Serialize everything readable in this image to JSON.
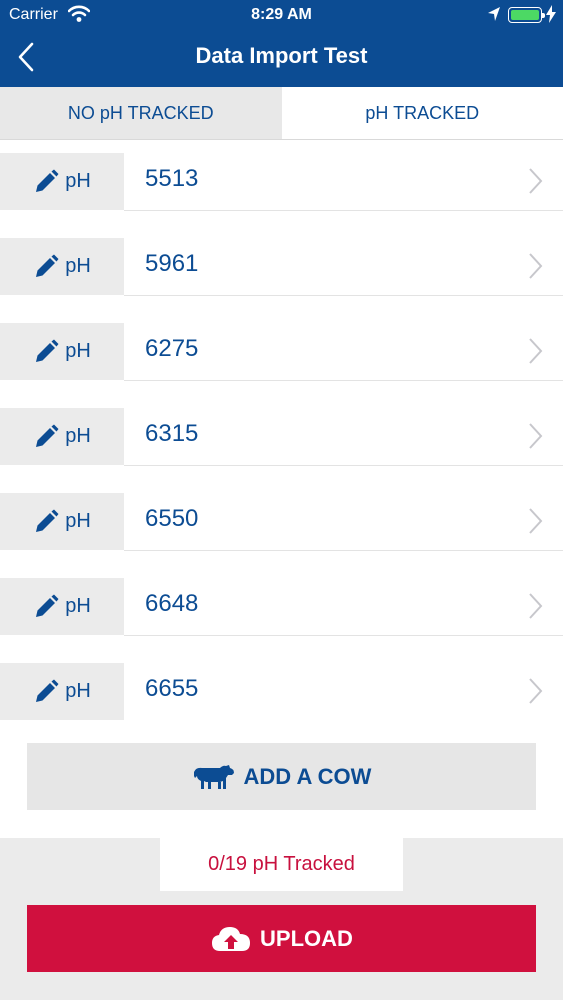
{
  "status_bar": {
    "carrier": "Carrier",
    "time": "8:29 AM",
    "icons": [
      "wifi-icon",
      "location-arrow-icon",
      "battery-icon",
      "charging-bolt-icon"
    ],
    "battery_color": "#4cd964"
  },
  "header": {
    "title": "Data Import Test",
    "back_icon": "chevron-left-icon",
    "background": "#0c4c93"
  },
  "tabs": [
    {
      "label": "NO pH TRACKED",
      "active": false
    },
    {
      "label": "pH TRACKED",
      "active": true
    }
  ],
  "rows": [
    {
      "ph_label": "pH",
      "number": "5513"
    },
    {
      "ph_label": "pH",
      "number": "5961"
    },
    {
      "ph_label": "pH",
      "number": "6275"
    },
    {
      "ph_label": "pH",
      "number": "6315"
    },
    {
      "ph_label": "pH",
      "number": "6550"
    },
    {
      "ph_label": "pH",
      "number": "6648"
    },
    {
      "ph_label": "pH",
      "number": "6655"
    }
  ],
  "add_cow": {
    "label": "ADD A COW",
    "icon": "cow-icon"
  },
  "tracked_status": "0/19 pH Tracked",
  "upload": {
    "label": "UPLOAD",
    "icon": "cloud-upload-icon",
    "background": "#d0103e"
  }
}
